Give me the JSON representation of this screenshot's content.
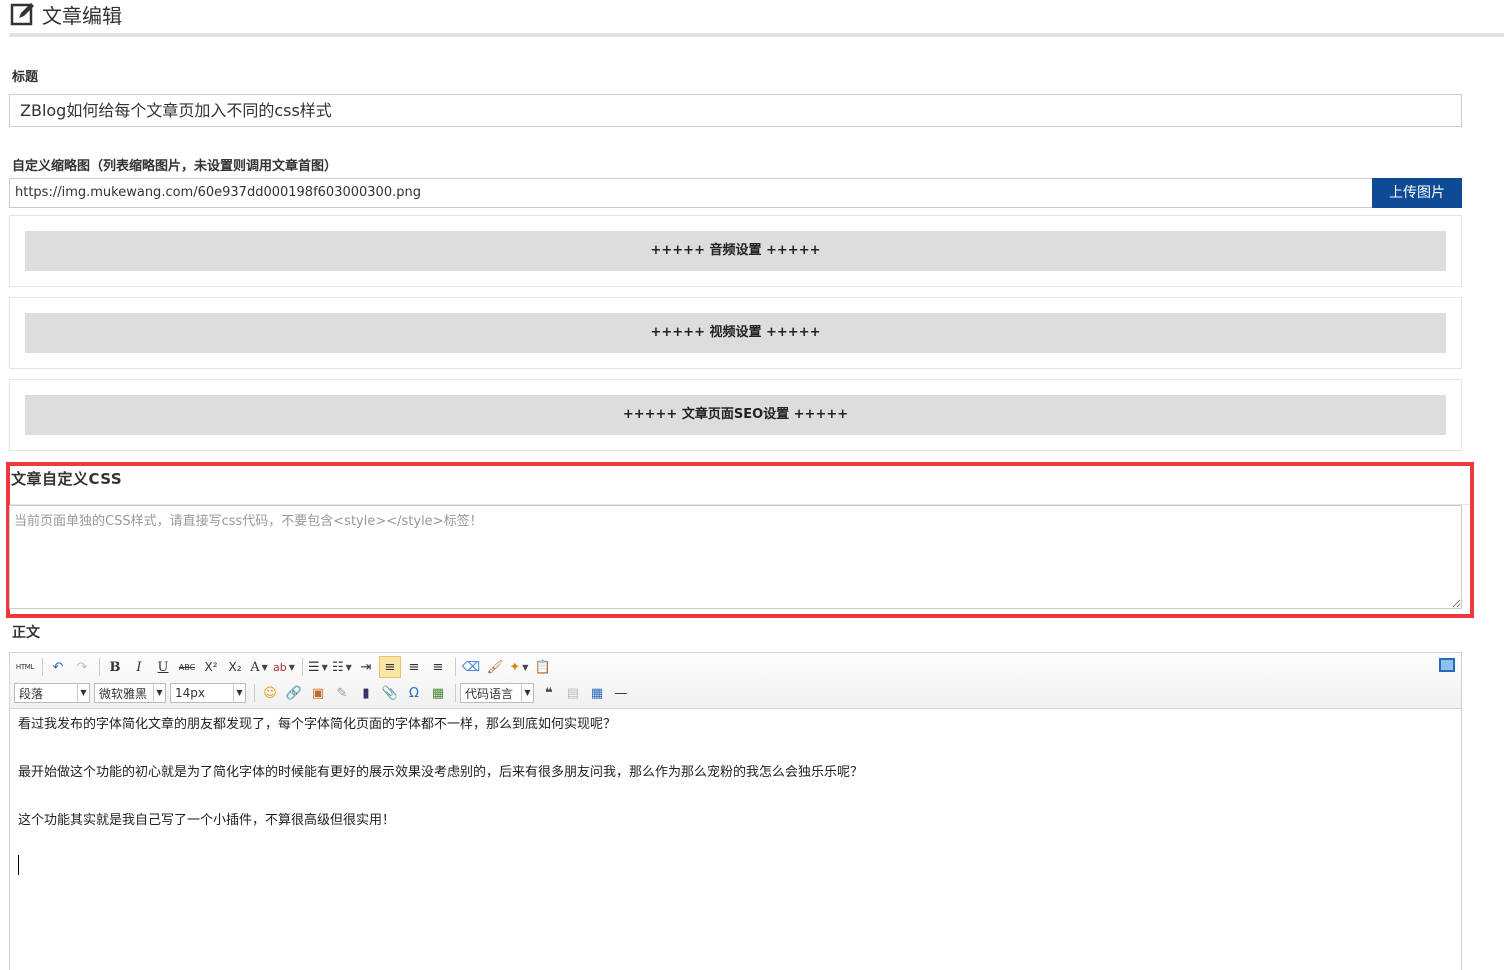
{
  "header": {
    "title": "文章编辑",
    "icon": "edit-icon"
  },
  "title_field": {
    "label": "标题",
    "value": "ZBlog如何给每个文章页加入不同的css样式"
  },
  "thumbnail": {
    "label": "自定义缩略图（列表缩略图片，未设置则调用文章首图）",
    "value": "https://img.mukewang.com/60e937dd000198f603000300.png",
    "upload_label": "上传图片"
  },
  "sections": {
    "audio": "+++++ 音频设置 +++++",
    "video": "+++++ 视频设置 +++++",
    "seo": "+++++ 文章页面SEO设置 +++++"
  },
  "custom_css": {
    "label": "文章自定义CSS",
    "placeholder": "当前页面单独的CSS样式，请直接写css代码，不要包含<style></style>标签！",
    "value": ""
  },
  "body": {
    "label": "正文",
    "toolbar": {
      "html_label": "HTML",
      "paragraph": "段落",
      "font_family": "微软雅黑",
      "font_size": "14px",
      "code_language": "代码语言",
      "bold": "B",
      "italic": "I",
      "underline": "U",
      "strike": "ABC",
      "superscript": "X²",
      "subscript": "X₂",
      "font_color": "A",
      "quote": "❝"
    },
    "paragraphs": [
      "看过我发布的字体简化文章的朋友都发现了，每个字体简化页面的字体都不一样，那么到底如何实现呢？",
      "最开始做这个功能的初心就是为了简化字体的时候能有更好的展示效果没考虑别的，后来有很多朋友问我，那么作为那么宠粉的我怎么会独乐乐呢？",
      "这个功能其实就是我自己写了一个小插件，不算很高级但很实用！"
    ]
  },
  "colors": {
    "accent": "#0f4a94",
    "highlight_frame": "#f0373c",
    "section_bar": "#dddddd"
  }
}
